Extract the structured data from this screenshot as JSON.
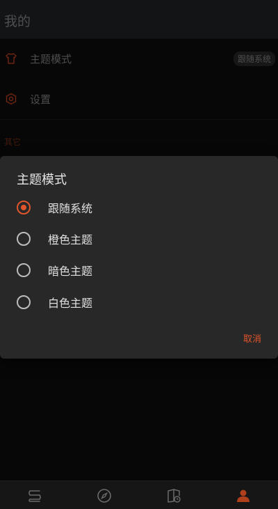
{
  "header": {
    "title": "我的"
  },
  "settings": {
    "theme_row": {
      "label": "主题模式",
      "value": "跟随系统"
    },
    "settings_row": {
      "label": "设置"
    },
    "section_other": "其它"
  },
  "dialog": {
    "title": "主题模式",
    "options": [
      {
        "label": "跟随系统",
        "selected": true
      },
      {
        "label": "橙色主题",
        "selected": false
      },
      {
        "label": "暗色主题",
        "selected": false
      },
      {
        "label": "白色主题",
        "selected": false
      }
    ],
    "cancel_label": "取消"
  },
  "bottom_nav": {
    "items": [
      {
        "icon": "bookshelf-icon",
        "active": false
      },
      {
        "icon": "compass-icon",
        "active": false
      },
      {
        "icon": "history-book-icon",
        "active": false
      },
      {
        "icon": "profile-icon",
        "active": true
      }
    ]
  },
  "colors": {
    "accent": "#e0552b",
    "background": "#0e0e0e",
    "dialog": "#282828"
  }
}
